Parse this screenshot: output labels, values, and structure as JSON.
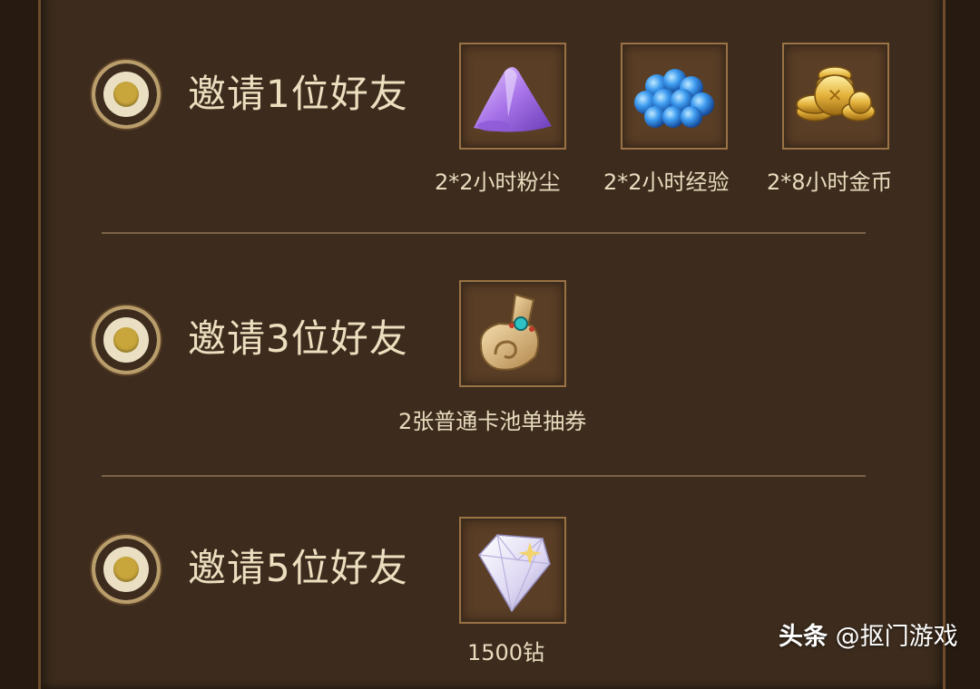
{
  "rewards": [
    {
      "title": "邀请1位好友",
      "items": [
        {
          "icon": "purple-dust-icon",
          "label": "2*2小时粉尘"
        },
        {
          "icon": "blue-exp-orbs-icon",
          "label": "2*2小时经验"
        },
        {
          "icon": "gold-coins-icon",
          "label": "2*8小时金币"
        }
      ]
    },
    {
      "title": "邀请3位好友",
      "items": [
        {
          "icon": "scroll-ticket-icon",
          "label": "2张普通卡池单抽券"
        }
      ]
    },
    {
      "title": "邀请5位好友",
      "items": [
        {
          "icon": "diamond-icon",
          "label": "1500钻"
        }
      ]
    }
  ],
  "watermark": {
    "brand": "头条",
    "account": "@抠门游戏"
  },
  "colors": {
    "panel": "#3d2c1d",
    "frame_border": "#6c4c2a",
    "text": "#ecdfc0",
    "radio_dot": "#c9a63b"
  }
}
